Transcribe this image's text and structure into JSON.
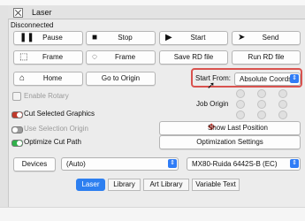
{
  "window": {
    "title": "Laser",
    "status": "Disconnected"
  },
  "buttons": {
    "pause": "Pause",
    "stop": "Stop",
    "start": "Start",
    "send": "Send",
    "frame1": "Frame",
    "frame2": "Frame",
    "save_rd": "Save RD file",
    "run_rd": "Run RD file",
    "home": "Home",
    "go_to_origin": "Go to Origin",
    "show_last_position": "Show Last Position",
    "optimization_settings": "Optimization Settings"
  },
  "start_from": {
    "label": "Start From:",
    "value": "Absolute Coords"
  },
  "job_origin": {
    "label": "Job Origin"
  },
  "options": {
    "enable_rotary": "Enable Rotary",
    "cut_selected_graphics": "Cut Selected Graphics",
    "use_selection_origin": "Use Selection Origin",
    "optimize_cut_path": "Optimize Cut Path"
  },
  "devices": {
    "button": "Devices",
    "port": "(Auto)",
    "model": "MX80-Ruida 6442S-B (EC)"
  },
  "tabs": [
    "Laser",
    "Library",
    "Art Library",
    "Variable Text"
  ],
  "colors": {
    "accent": "#2d7ff0",
    "highlight": "#d9534f"
  }
}
